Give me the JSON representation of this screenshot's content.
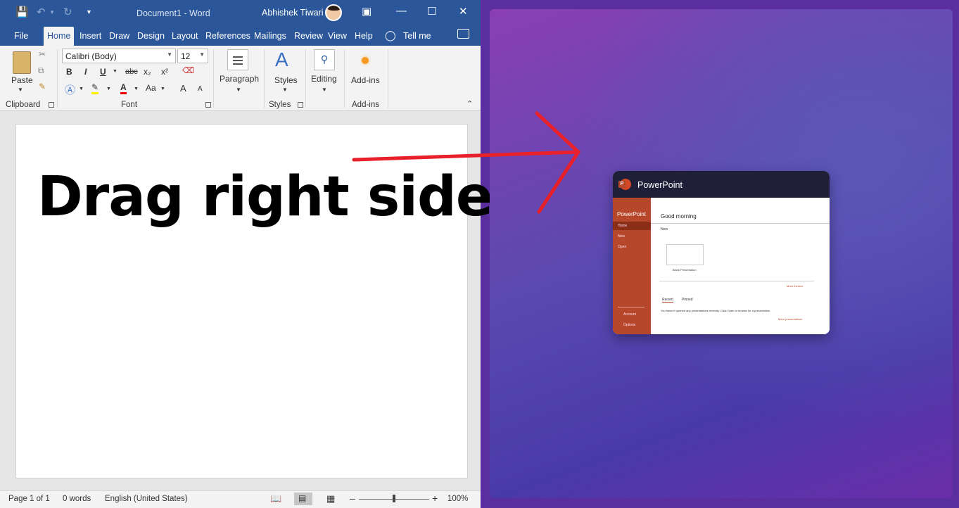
{
  "word": {
    "doc_title": "Document1  -  Word",
    "user_name": "Abhishek Tiwari",
    "tabs": [
      "File",
      "Home",
      "Insert",
      "Draw",
      "Design",
      "Layout",
      "References",
      "Mailings",
      "Review",
      "View",
      "Help"
    ],
    "tell_me": "Tell me",
    "ribbon": {
      "paste": "Paste",
      "clipboard": "Clipboard",
      "font_name": "Calibri (Body)",
      "font_size": "12",
      "font": "Font",
      "paragraph": "Paragraph",
      "styles_btn": "Styles",
      "styles": "Styles",
      "editing": "Editing",
      "addins_btn": "Add-ins",
      "addins": "Add-ins",
      "bold": "B",
      "italic": "I",
      "underline": "U",
      "strike": "abc",
      "subscript": "x₂",
      "superscript": "x²",
      "change_case": "Aa",
      "grow": "A",
      "shrink": "A"
    },
    "document_text": "Drag right side",
    "status": {
      "page": "Page 1 of 1",
      "words": "0 words",
      "language": "English (United States)",
      "zoom": "100%"
    }
  },
  "powerpoint_thumbnail": {
    "title": "PowerPoint",
    "brand": "PowerPoint",
    "greeting": "Good morning",
    "nav": [
      "Home",
      "New",
      "Open"
    ],
    "nav_bottom": [
      "Account",
      "Options"
    ],
    "new_label": "New",
    "blank": "Blank Presentation",
    "more_themes": "More themes",
    "tabs": [
      "Recent",
      "Pinned"
    ],
    "empty_msg": "You haven't opened any presentations recently. Click Open to browse for a presentation.",
    "more_presentations": "More presentations"
  },
  "colors": {
    "word_blue": "#2b579a",
    "ppt_orange": "#b7472a",
    "arrow_red": "#e8202a"
  }
}
